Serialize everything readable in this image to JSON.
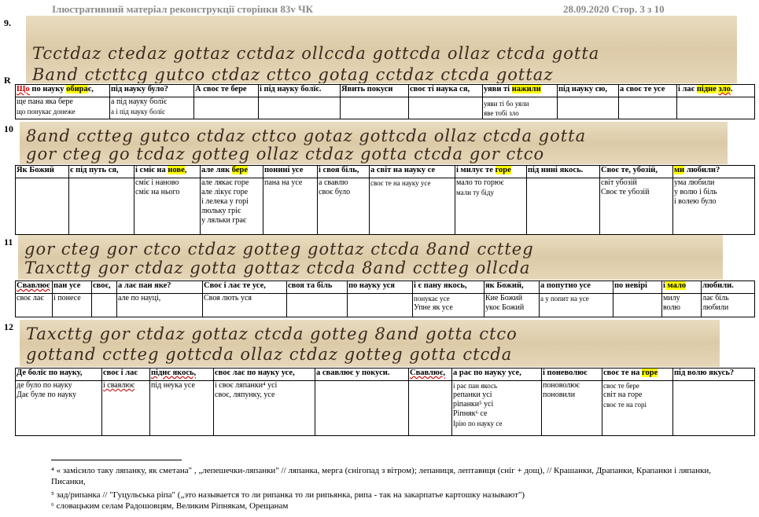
{
  "header": {
    "title": "Ілюстративний матеріал  реконструкції сторінки 83v ЧК",
    "date_page": "28.09.2020  Стор. 3 з 10"
  },
  "blocks": [
    {
      "num": "9.",
      "mark": "R",
      "lines": [
        "Tcctdaz ctedaz gottaz cctdaz ollccda gottcda ollaz ctcda gotta",
        "Band ctcttcg gutco ctdaz cttco gotag cctdaz ctcda gottaz"
      ],
      "headers": [
        [
          "Що",
          " по науку ",
          "обира",
          "є,"
        ],
        "під науку було?",
        "А своє те бере",
        "і під науку болїє.",
        "Явить покуси",
        "своє ті наука ся,",
        [
          "уяви ті ",
          "нажили",
          ""
        ],
        "під науку сю,",
        "а своє те усе",
        [
          "і лає ",
          "підне",
          " ",
          "зло",
          "."
        ]
      ],
      "cells": [
        [
          "ще пана яка бере",
          "що понукає донеже"
        ],
        [
          "а під науку болїє",
          "а і під науку болїє"
        ],
        [],
        [],
        [],
        [],
        [
          "уяви ті бо уяли",
          "яве тобі зло"
        ],
        [],
        [],
        []
      ]
    },
    {
      "num": "10",
      "lines": [
        "8and cctteg gutco ctdaz cttco gotaz gottcda ollaz ctcda gotta",
        "gor cteg go tcdaz gotteg ollaz ctdaz gotta ctcda gor ctco"
      ],
      "headers": [
        "Як Божий",
        "є під путь ся,",
        [
          "і сміє на ",
          "нове",
          ","
        ],
        [
          "але ляк ",
          "бере"
        ],
        "понині усе",
        "і своя біль,",
        "а світ на науку се",
        [
          "і милує те ",
          "горе"
        ],
        "під нині якось.",
        "Своє те, убозій,",
        [
          "ми",
          " любили?"
        ]
      ],
      "cells": [
        [],
        [],
        [
          "сміє і наново",
          "сміє на нього"
        ],
        [
          "але лякає горе",
          "але лікує горе",
          "і лелека у горі",
          "люльку гріє",
          "у ляльки грає"
        ],
        [
          "пана на усе"
        ],
        [
          "а свавлю",
          "своє було"
        ],
        [
          "своє те на науку усе"
        ],
        [
          "мало то горює",
          "мали ту біду"
        ],
        [],
        [
          "світ убозій",
          "Своє те убозій"
        ],
        [
          "ума любили",
          "у волю і біль",
          "і волею було"
        ]
      ]
    },
    {
      "num": "11",
      "lines": [
        "gor cteg gor ctco ctdaz gotteg gottaz ctcda 8and cctteg",
        "Taxcttg gor ctdaz gotta gottaz ctcda 8and cctteg ollcda"
      ],
      "headers": [
        "Свавлює",
        "пан усе",
        "своє,",
        "а лає пан яке?",
        "Своє і лає те усе,",
        "своя та біль",
        "по науку уся",
        "і є пану якось,",
        "як Божий,",
        "а попутно усе",
        "по невірі",
        [
          "і",
          " мало"
        ],
        "любили."
      ],
      "cells": [
        [
          "своє лає"
        ],
        [
          "і понесе"
        ],
        [],
        [
          "але по науці,"
        ],
        [
          "Своя лють уся"
        ],
        [],
        [],
        [
          "понукає усе",
          "Упне як усе"
        ],
        [
          "Кие Божий",
          "укоє Божий"
        ],
        [
          "а у попит на усе"
        ],
        [],
        [
          "милу",
          "волю"
        ],
        [
          "лає біль",
          "любили"
        ]
      ]
    },
    {
      "num": "12",
      "lines": [
        "Taxcttg gor ctdaz gottaz ctcda gotteg 8and gotta ctco",
        "gottand cctteg gottcda ollaz ctdaz gotteg gotta ctcda"
      ],
      "headers": [
        "Де болїє по науку,",
        "своє і лає",
        "піднє якось,",
        "своє лає по науку усе,",
        "а свавлює у покуси.",
        "Свавлює,",
        "а рає по науку усе,",
        "і поневолює",
        [
          "своє те на ",
          "горе"
        ],
        "під волю якусь?"
      ],
      "cells": [
        [
          "де було по науку",
          "Дає буле по науку"
        ],
        [
          "і свавлює"
        ],
        [
          "під неука усе"
        ],
        [
          "і своє ляпанки⁴ усі",
          "своє, ляпунку, усе"
        ],
        [],
        [],
        [
          "і рає пан якось",
          "репанки усі",
          "ріпанки⁵ усі",
          "Ріпняк⁶ се",
          "Ірію по науку се"
        ],
        [
          "поноволює",
          "поновили"
        ],
        [
          "своє те бере",
          "світ на горе",
          "своє те на горі"
        ],
        []
      ]
    }
  ],
  "footnotes": [
    "⁴ « замісило таку ляпанку, як сметана\" , „лепешечки-ляпанки\" // ляпанка, мерга (снігопад з вітром); лепаниця, лептавиця (сніг + дощ), // Крашанки, Драпанки, Крапанки і ляпанки, Писанки,",
    "⁵ зад/рипанка // \"Гуцульська ріпа\" („это называется то ли рипанка то ли рипьянка, рипа - так на закарпатье картошку называют\")",
    "⁶ словацьким селам Радошовцям, Великим Ріпнякам, Орещанам"
  ]
}
